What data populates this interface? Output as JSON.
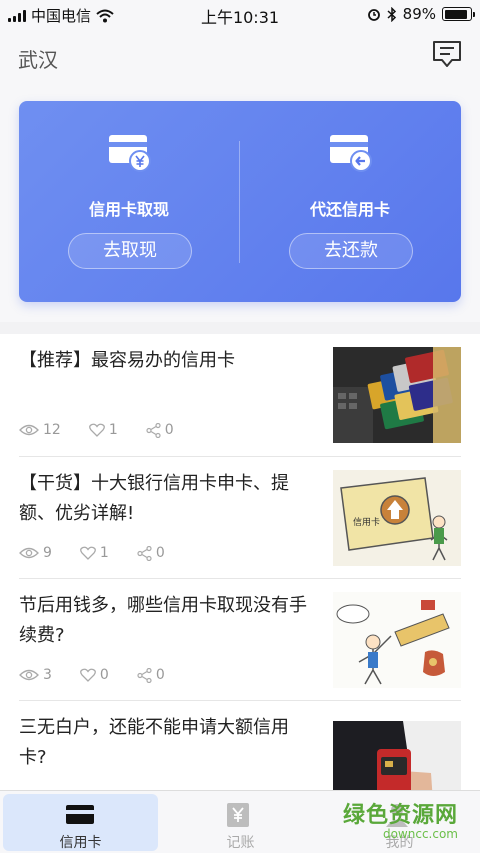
{
  "status_bar": {
    "carrier": "中国电信",
    "time": "上午10:31",
    "battery": "89%",
    "battery_level": 0.89
  },
  "header": {
    "city": "武汉",
    "icon": "message-icon"
  },
  "actions": [
    {
      "title": "信用卡取现",
      "button": "去取现",
      "icon": "card-yen-icon"
    },
    {
      "title": "代还信用卡",
      "button": "去还款",
      "icon": "card-repay-icon"
    }
  ],
  "articles": [
    {
      "title": "【推荐】最容易办的信用卡",
      "views": "12",
      "likes": "1",
      "shares": "0",
      "thumb": "credit-cards-photo"
    },
    {
      "title": "【干货】十大银行信用卡申卡、提额、优劣详解!",
      "views": "9",
      "likes": "1",
      "shares": "0",
      "thumb": "credit-card-cartoon"
    },
    {
      "title": "节后用钱多，哪些信用卡取现没有手续费?",
      "views": "3",
      "likes": "0",
      "shares": "0",
      "thumb": "fee-cartoon"
    },
    {
      "title": "三无白户，还能不能申请大额信用卡?",
      "views": "",
      "likes": "",
      "shares": "",
      "thumb": "hand-card-photo"
    }
  ],
  "tabs": [
    {
      "label": "信用卡",
      "icon": "credit-card-icon",
      "active": true
    },
    {
      "label": "记账",
      "icon": "yen-ledger-icon",
      "active": false
    },
    {
      "label": "我的",
      "icon": "user-icon",
      "active": false
    }
  ],
  "watermark": {
    "line1": "绿色资源网",
    "line2": "downcc.com"
  },
  "colors": {
    "card_gradient_start": "#6f8ff1",
    "card_gradient_end": "#5877ec",
    "active_tab_bg": "#dbe7fb"
  }
}
